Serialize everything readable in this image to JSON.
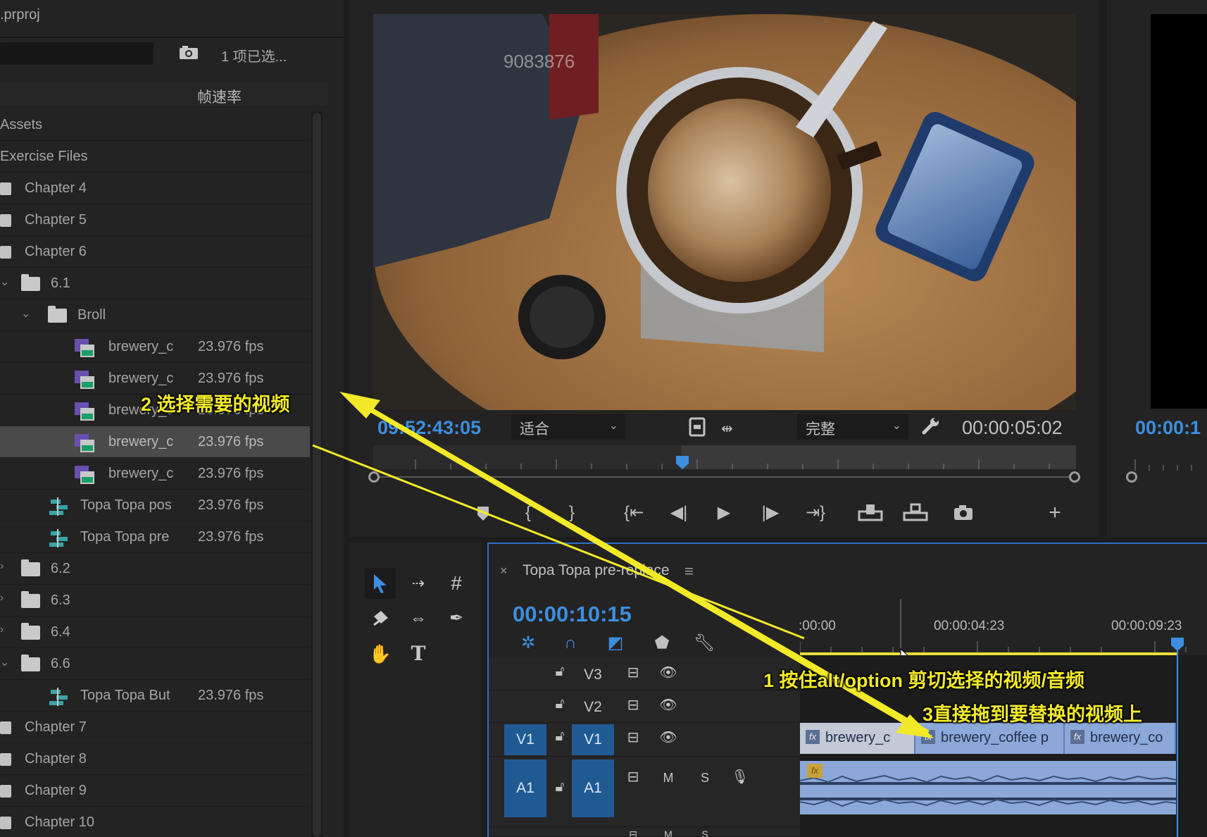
{
  "project": {
    "title": ".prproj",
    "selection_count": "1 项已选...",
    "column_header": "帧速率",
    "rows": [
      {
        "kind": "bin-root",
        "name": "Assets"
      },
      {
        "kind": "bin-root",
        "name": "Exercise Files"
      },
      {
        "kind": "bin",
        "name": "Chapter 4"
      },
      {
        "kind": "bin",
        "name": "Chapter 5"
      },
      {
        "kind": "bin",
        "name": "Chapter 6"
      },
      {
        "kind": "folder-open",
        "name": "6.1"
      },
      {
        "kind": "folder-open",
        "name": "Broll"
      },
      {
        "kind": "clip",
        "name": "brewery_c",
        "fps": "23.976 fps"
      },
      {
        "kind": "clip",
        "name": "brewery_c",
        "fps": "23.976 fps"
      },
      {
        "kind": "clip",
        "name": "brewery_c",
        "fps": "23.976 fps"
      },
      {
        "kind": "clip",
        "name": "brewery_c",
        "fps": "23.976 fps",
        "selected": true
      },
      {
        "kind": "clip",
        "name": "brewery_c",
        "fps": "23.976 fps"
      },
      {
        "kind": "sequence",
        "name": "Topa Topa pos",
        "fps": "23.976 fps"
      },
      {
        "kind": "sequence",
        "name": "Topa Topa pre",
        "fps": "23.976 fps"
      },
      {
        "kind": "folder",
        "name": "6.2"
      },
      {
        "kind": "folder",
        "name": "6.3"
      },
      {
        "kind": "folder",
        "name": "6.4"
      },
      {
        "kind": "folder-open",
        "name": "6.6"
      },
      {
        "kind": "sequence",
        "name": "Topa Topa But",
        "fps": "23.976 fps"
      },
      {
        "kind": "bin",
        "name": "Chapter 7"
      },
      {
        "kind": "bin",
        "name": "Chapter 8"
      },
      {
        "kind": "bin",
        "name": "Chapter 9"
      },
      {
        "kind": "bin",
        "name": "Chapter 10"
      }
    ]
  },
  "program_monitor": {
    "watermark": "9083876",
    "timecode_current": "09:52:43:05",
    "fit_label": "适合",
    "quality_label": "完整",
    "timecode_duration": "00:00:05:02",
    "playhead_fraction": 0.44
  },
  "source_monitor": {
    "timecode": "00:00:1"
  },
  "timeline": {
    "close_label": "×",
    "sequence_name": "Topa Topa pre-replace",
    "menu_label": "≡",
    "timecode": "00:00:10:15",
    "ruler_times": [
      ":00:00",
      "00:00:04:23",
      "00:00:09:23"
    ],
    "tracks": {
      "v3": {
        "label": "V3"
      },
      "v2": {
        "label": "V2"
      },
      "v1": {
        "source": "V1",
        "label": "V1"
      },
      "a1": {
        "source": "A1",
        "label": "A1",
        "mute": "M",
        "solo": "S"
      },
      "a2": {
        "mute": "M",
        "solo": "S"
      }
    },
    "clips_v1": [
      {
        "label": "brewery_c",
        "fx": "fx"
      },
      {
        "label": "brewery_coffee p",
        "fx": "fx"
      },
      {
        "label": "brewery_co",
        "fx": "fx"
      }
    ],
    "audio_fx": "fx"
  },
  "annotations": {
    "step1": "1 按住alt/option 剪切选择的视频/音频",
    "step2": "2 选择需要的视频",
    "step3": "3直接拖到要替换的视频上",
    "color": "#f2ea29"
  },
  "colors": {
    "accent_blue": "#3d8ee0",
    "work_area": "#e9dd3c",
    "clip_video": "#8ba8d8",
    "track_target": "#205a93"
  }
}
